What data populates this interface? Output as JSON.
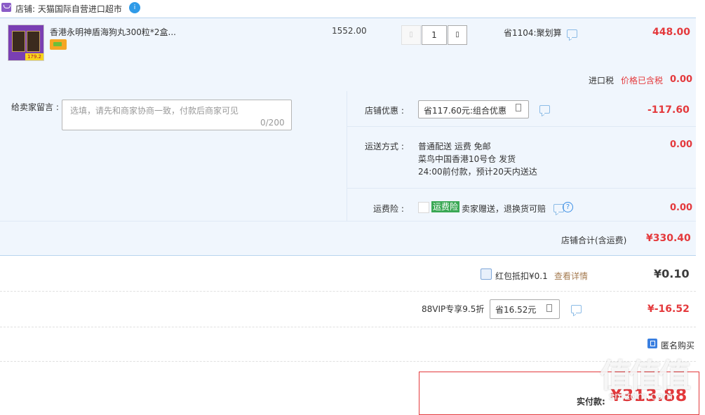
{
  "shop": {
    "label": "店铺: 天猫国际自营进口超市",
    "badge": "i"
  },
  "item": {
    "title": "香港永明神盾海狗丸300粒*2盒...",
    "thumb_tag": "179.2",
    "unit_price": "1552.00",
    "quantity": "1",
    "qty_minus": "▯",
    "qty_plus": "▯",
    "save_text": "省1104:聚划算",
    "subtotal": "448.00",
    "tax_label": "进口税",
    "tax_note": "价格已含税",
    "tax_value": "0.00"
  },
  "message": {
    "label": "给卖家留言 :",
    "placeholder": "选填，请先和商家协商一致，付款后商家可见",
    "count": "0/200"
  },
  "discount": {
    "label": "店铺优惠 :",
    "selected": "省117.60元:组合优惠",
    "value": "-117.60"
  },
  "shipping": {
    "label": "运送方式 :",
    "line1": "普通配送 运费 免邮",
    "line2": "菜鸟中国香港10号仓   发货",
    "line3": "24:00前付款，预计20天内送达",
    "value": "0.00"
  },
  "insurance": {
    "label": "运费险 :",
    "tag": "运费险",
    "desc": "卖家赠送，退换货可赔",
    "help": "?",
    "value": "0.00"
  },
  "shop_total": {
    "label": "店铺合计(含运费)",
    "value": "¥330.40"
  },
  "red_packet": {
    "label": "红包抵扣¥0.1",
    "detail": "查看详情",
    "value": "¥0.10"
  },
  "vip": {
    "label": "88VIP专享9.5折",
    "selected": "省16.52元",
    "value": "¥-16.52"
  },
  "anonymous": {
    "label": "匿名购买"
  },
  "payment": {
    "label": "实付款:",
    "value": "¥313.88"
  },
  "watermark": {
    "text": "值值值",
    "sub": "smzdm.com"
  },
  "icons": {
    "shop": "shop-icon",
    "coupon": "coupon-icon",
    "message": "message-icon",
    "help": "help-icon",
    "checkbox": "checkbox-icon"
  },
  "colors": {
    "price_red": "#e4393c",
    "panel_bg": "#f0f6fd",
    "insurance_green": "#3aa854",
    "link_brown": "#a67c52"
  }
}
